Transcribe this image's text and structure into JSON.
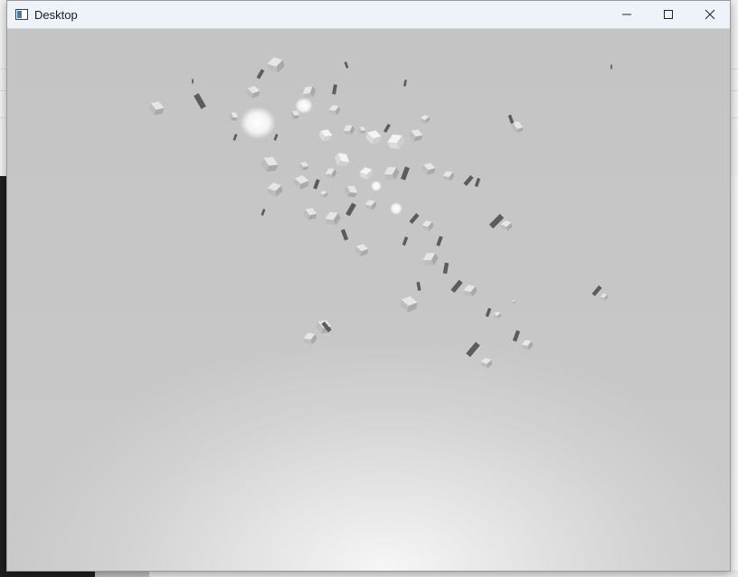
{
  "window": {
    "title": "Desktop"
  },
  "titlebar": {
    "app_icon": "window-app-icon",
    "controls": [
      {
        "name": "minimize-button",
        "icon": "minimize-icon"
      },
      {
        "name": "maximize-button",
        "icon": "maximize-icon"
      },
      {
        "name": "close-button",
        "icon": "close-icon"
      }
    ]
  },
  "viewport": {
    "content": "3d-scene-of-scattered-cubes",
    "background_color": "#c8c8c8",
    "cube_color_light": "#e6e6e6",
    "cube_color_dark": "#5c5c5c"
  }
}
